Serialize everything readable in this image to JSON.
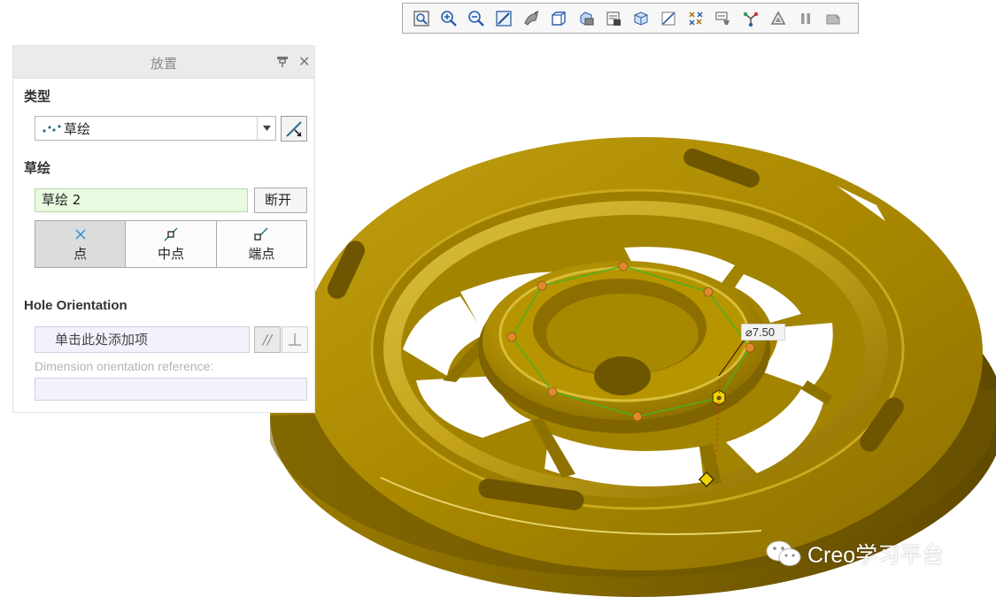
{
  "toolbar": {
    "icons": [
      "zoom-fit-icon",
      "zoom-in-icon",
      "zoom-out-icon",
      "refit-icon",
      "shading-icon",
      "orient-icon",
      "saved-views-icon",
      "view-manager-icon",
      "perspective-icon",
      "section-icon",
      "datum-display-icon",
      "annotation-icon",
      "spin-center-icon",
      "appearance-icon",
      "pause-icon",
      "next-icon"
    ]
  },
  "panel": {
    "title": "放置",
    "type_label": "类型",
    "type_value": "草绘",
    "sketch_label": "草绘",
    "sketch_value": "草绘 2",
    "break_label": "断开",
    "snap_buttons": [
      "点",
      "中点",
      "端点"
    ],
    "hole_orientation_label": "Hole Orientation",
    "add_item_placeholder": "单击此处添加项",
    "parallel_symbol": "//",
    "dimension_reference_label": "Dimension orientation reference:"
  },
  "viewport": {
    "dimension_value": "⌀7.50",
    "watermark": "Creo学习平台"
  },
  "colors": {
    "part_gold": "#b08c00",
    "sketch_green": "#4caf20",
    "field_green": "#e8fbe0",
    "field_lavender": "#f3f1fb"
  }
}
